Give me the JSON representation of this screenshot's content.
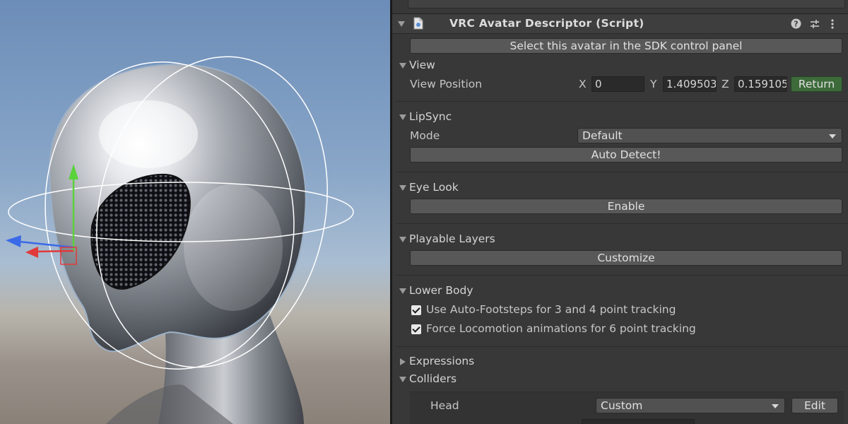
{
  "component": {
    "title": "VRC Avatar Descriptor (Script)",
    "icons": [
      "script-icon",
      "help-icon",
      "preset-icon",
      "more-icon"
    ],
    "select_button": "Select this avatar in the SDK control panel"
  },
  "view": {
    "header": "View",
    "position_label": "View Position",
    "x_label": "X",
    "x_value": "0",
    "y_label": "Y",
    "y_value": "1.409503",
    "z_label": "Z",
    "z_value": "0.159105",
    "return_button": "Return"
  },
  "lipsync": {
    "header": "LipSync",
    "mode_label": "Mode",
    "mode_value": "Default",
    "auto_detect_button": "Auto Detect!"
  },
  "eye_look": {
    "header": "Eye Look",
    "enable_button": "Enable"
  },
  "playable_layers": {
    "header": "Playable Layers",
    "customize_button": "Customize"
  },
  "lower_body": {
    "header": "Lower Body",
    "auto_footsteps_label": "Use Auto-Footsteps for 3 and 4 point tracking",
    "auto_footsteps_checked": true,
    "force_locomotion_label": "Force Locomotion animations for 6 point tracking",
    "force_locomotion_checked": true
  },
  "expressions": {
    "header": "Expressions"
  },
  "colliders": {
    "header": "Colliders",
    "head_label": "Head",
    "head_value": "Custom",
    "edit_button": "Edit"
  },
  "colors": {
    "panel_bg": "#383838",
    "button_bg": "#585858",
    "field_bg": "#2a2a2a",
    "return_green": "#3d6b3a",
    "gizmo_y": "#5ad23c",
    "gizmo_x": "#e03a3a",
    "gizmo_z": "#3a6ae8"
  }
}
